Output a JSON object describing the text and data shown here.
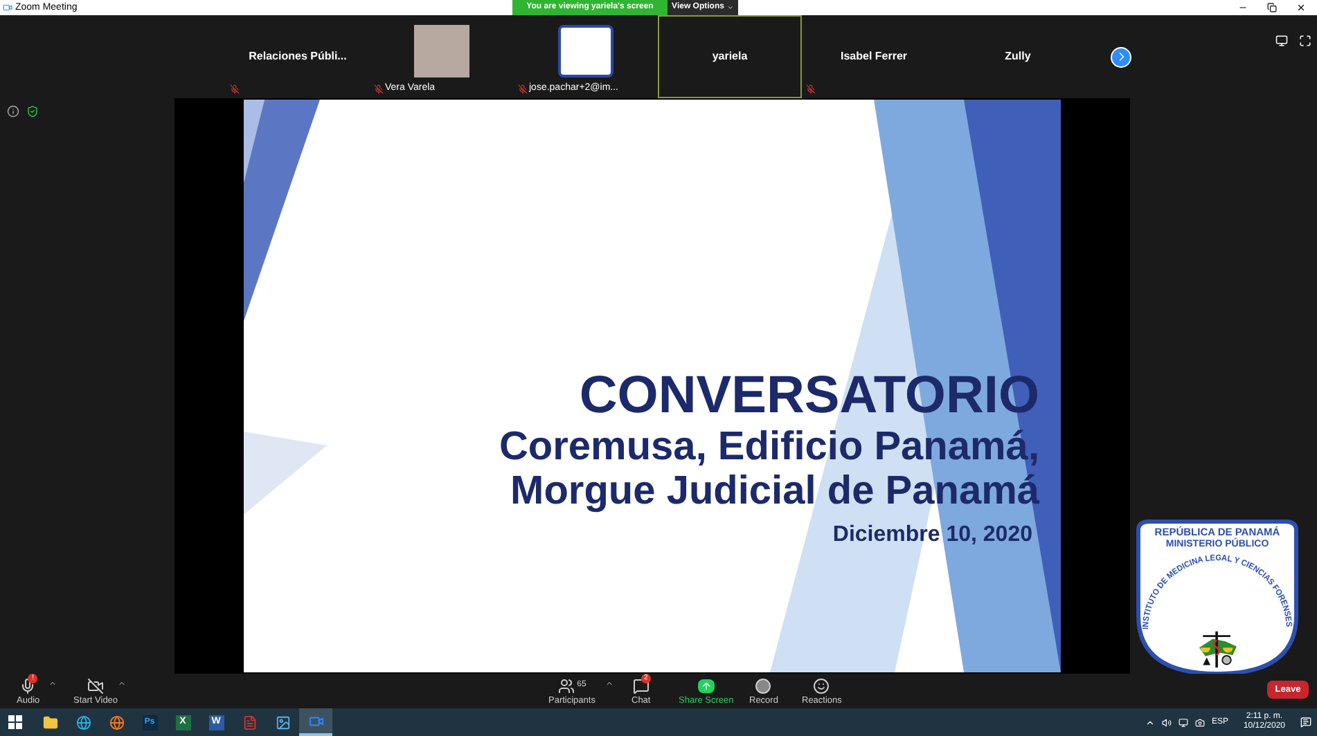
{
  "window": {
    "title": "Zoom Meeting"
  },
  "banner": {
    "text": "You are viewing yariela's screen",
    "view_options": "View Options"
  },
  "participants": [
    {
      "kind": "name",
      "name": "Relaciones  Públi...",
      "muted": true,
      "active": false
    },
    {
      "kind": "photo",
      "name": "Vera Varela",
      "muted": true,
      "active": false
    },
    {
      "kind": "logo",
      "name": "jose.pachar+2@im...",
      "muted": true,
      "active": false
    },
    {
      "kind": "name",
      "name": "yariela",
      "muted": false,
      "active": true
    },
    {
      "kind": "name",
      "name": "Isabel Ferrer",
      "muted": true,
      "active": false
    },
    {
      "kind": "name",
      "name": "Zully",
      "muted": false,
      "active": false
    }
  ],
  "slide": {
    "title": "CONVERSATORIO",
    "subtitle_lines": [
      "Coremusa, Edificio Panamá,",
      "Morgue Judicial de Panamá"
    ],
    "date": "Diciembre 10, 2020"
  },
  "emblem": {
    "line_1": "REPÚBLICA DE PANAMÁ",
    "line_2": "MINISTERIO PÚBLICO",
    "ring_text": "INSTITUTO DE MEDICINA LEGAL Y CIENCIAS FORENSES"
  },
  "toolbar": [
    {
      "kind": "audio",
      "label": "Audio",
      "badge": "!"
    },
    {
      "kind": "video",
      "label": "Start Video"
    },
    {
      "kind": "participants",
      "label": "Participants",
      "count": "65"
    },
    {
      "kind": "chat",
      "label": "Chat",
      "badge": "2"
    },
    {
      "kind": "share",
      "label": "Share Screen"
    },
    {
      "kind": "record",
      "label": "Record"
    },
    {
      "kind": "reactions",
      "label": "Reactions"
    }
  ],
  "leave": "Leave",
  "taskbar": {
    "apps": [
      {
        "kind": "explorer",
        "active": false
      },
      {
        "kind": "edge",
        "active": false
      },
      {
        "kind": "firefox",
        "active": false
      },
      {
        "kind": "photoshop",
        "glyph": "Ps",
        "active": false
      },
      {
        "kind": "excel",
        "glyph": "X",
        "active": false
      },
      {
        "kind": "word",
        "glyph": "W",
        "active": false
      },
      {
        "kind": "acrobat",
        "active": false
      },
      {
        "kind": "photos",
        "active": false
      },
      {
        "kind": "zoom",
        "active": true
      }
    ],
    "language": "ESP",
    "time": "2:11 p. m.",
    "date": "10/12/2020"
  }
}
